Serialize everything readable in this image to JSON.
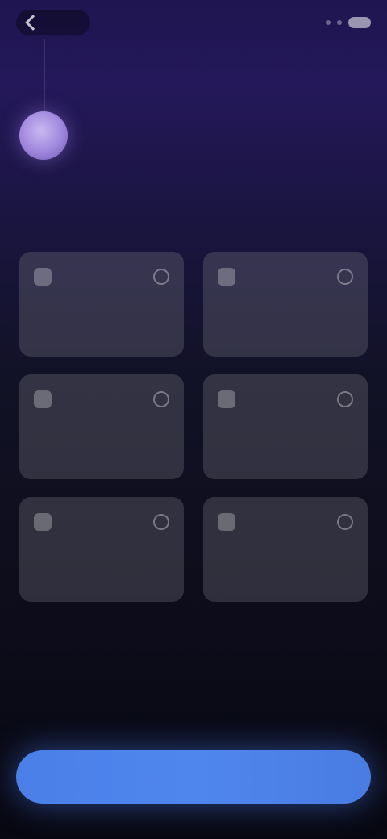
{
  "top_bar": {
    "back_label": "",
    "back_icon": "chevron-left-icon",
    "status_icon": "battery-icon"
  },
  "header": {
    "avatar_icon": "assistant-avatar",
    "title": "",
    "subtitle": ""
  },
  "options": [
    {
      "label": "",
      "icon": "option-icon"
    },
    {
      "label": "",
      "icon": "option-icon"
    },
    {
      "label": "",
      "icon": "option-icon"
    },
    {
      "label": "",
      "icon": "option-icon"
    },
    {
      "label": "",
      "icon": "option-icon"
    },
    {
      "label": "",
      "icon": "option-icon"
    }
  ],
  "cta": {
    "label": ""
  },
  "colors": {
    "background_top": "#24185a",
    "background_bottom": "#080812",
    "card": "#5a5a66",
    "accent": "#4f86ee",
    "avatar": "#9e86dc"
  }
}
